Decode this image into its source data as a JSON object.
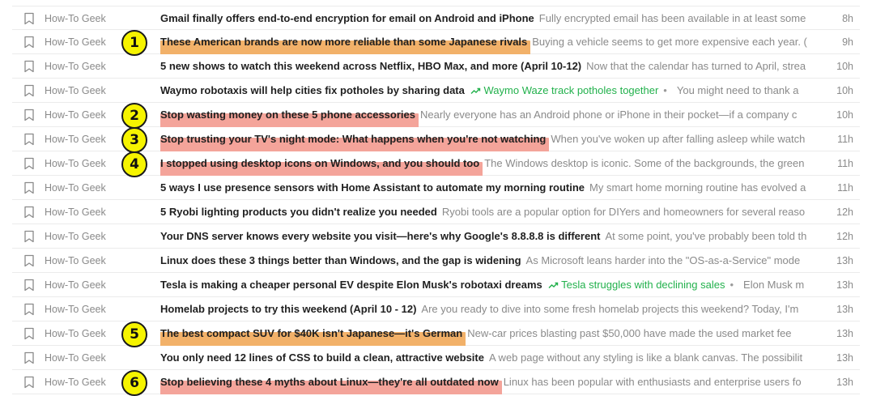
{
  "feed": {
    "items": [
      {
        "source": "How-To Geek",
        "title": "Gmail finally offers end-to-end encryption for email on Android and iPhone",
        "highlight": "",
        "tag": "",
        "snippet": "Fully encrypted email has been available in at least some",
        "time": "8h"
      },
      {
        "source": "How-To Geek",
        "title": "These American brands are now more reliable than some Japanese rivals",
        "highlight": "orange",
        "tag": "",
        "snippet": "Buying a vehicle seems to get more expensive each year. (",
        "time": "9h"
      },
      {
        "source": "How-To Geek",
        "title": "5 new shows to watch this weekend across Netflix, HBO Max, and more (April 10-12)",
        "highlight": "",
        "tag": "",
        "snippet": "Now that the calendar has turned to April, strea",
        "time": "10h"
      },
      {
        "source": "How-To Geek",
        "title": "Waymo robotaxis will help cities fix potholes by sharing data",
        "highlight": "",
        "tag": "Waymo Waze track potholes together",
        "snippet": "You might need to thank a",
        "time": "10h"
      },
      {
        "source": "How-To Geek",
        "title": "Stop wasting money on these 5 phone accessories",
        "highlight": "red",
        "tag": "",
        "snippet": "Nearly everyone has an Android phone or iPhone in their pocket—if a company c",
        "time": "10h"
      },
      {
        "source": "How-To Geek",
        "title": "Stop trusting your TV's night mode: What happens when you're not watching",
        "highlight": "red",
        "tag": "",
        "snippet": "When you've woken up after falling asleep while watch",
        "time": "11h"
      },
      {
        "source": "How-To Geek",
        "title": "I stopped using desktop icons on Windows, and you should too",
        "highlight": "red",
        "tag": "",
        "snippet": "The Windows desktop is iconic. Some of the backgrounds, the green",
        "time": "11h"
      },
      {
        "source": "How-To Geek",
        "title": "5 ways I use presence sensors with Home Assistant to automate my morning routine",
        "highlight": "",
        "tag": "",
        "snippet": "My smart home morning routine has evolved a",
        "time": "11h"
      },
      {
        "source": "How-To Geek",
        "title": "5 Ryobi lighting products you didn't realize you needed",
        "highlight": "",
        "tag": "",
        "snippet": "Ryobi tools are a popular option for DIYers and homeowners for several reaso",
        "time": "12h"
      },
      {
        "source": "How-To Geek",
        "title": "Your DNS server knows every website you visit—here's why Google's 8.8.8.8 is different",
        "highlight": "",
        "tag": "",
        "snippet": "At some point, you've probably been told th",
        "time": "12h"
      },
      {
        "source": "How-To Geek",
        "title": "Linux does these 3 things better than Windows, and the gap is widening",
        "highlight": "",
        "tag": "",
        "snippet": "As Microsoft leans harder into the \"OS-as-a-Service\" mode",
        "time": "13h"
      },
      {
        "source": "How-To Geek",
        "title": "Tesla is making a cheaper personal EV despite Elon Musk's robotaxi dreams",
        "highlight": "",
        "tag": "Tesla struggles with declining sales",
        "snippet": "Elon Musk m",
        "time": "13h"
      },
      {
        "source": "How-To Geek",
        "title": "Homelab projects to try this weekend (April 10 - 12)",
        "highlight": "",
        "tag": "",
        "snippet": "Are you ready to dive into some fresh homelab projects this weekend? Today, I'm",
        "time": "13h"
      },
      {
        "source": "How-To Geek",
        "title": "The best compact SUV for $40K isn't Japanese—it's German",
        "highlight": "orange",
        "tag": "",
        "snippet": "New-car prices blasting past $50,000 have made the used market fee",
        "time": "13h"
      },
      {
        "source": "How-To Geek",
        "title": "You only need 12 lines of CSS to build a clean, attractive website",
        "highlight": "",
        "tag": "",
        "snippet": "A web page without any styling is like a blank canvas. The possibilit",
        "time": "13h"
      },
      {
        "source": "How-To Geek",
        "title": "Stop believing these 4 myths about Linux—they're all outdated now",
        "highlight": "red",
        "tag": "",
        "snippet": "Linux has been popular with enthusiasts and enterprise users fo",
        "time": "13h"
      }
    ]
  },
  "annotations": [
    {
      "label": "1",
      "row": 1
    },
    {
      "label": "2",
      "row": 4
    },
    {
      "label": "3",
      "row": 5
    },
    {
      "label": "4",
      "row": 6
    },
    {
      "label": "5",
      "row": 13
    },
    {
      "label": "6",
      "row": 15
    }
  ],
  "colors": {
    "highlight_orange": "#f2b169",
    "highlight_red": "#f4a49a",
    "tag_green": "#22b14c",
    "badge_yellow": "#f6f400"
  },
  "icons": {
    "bookmark": "bookmark-icon",
    "trend": "trend-up-icon"
  }
}
